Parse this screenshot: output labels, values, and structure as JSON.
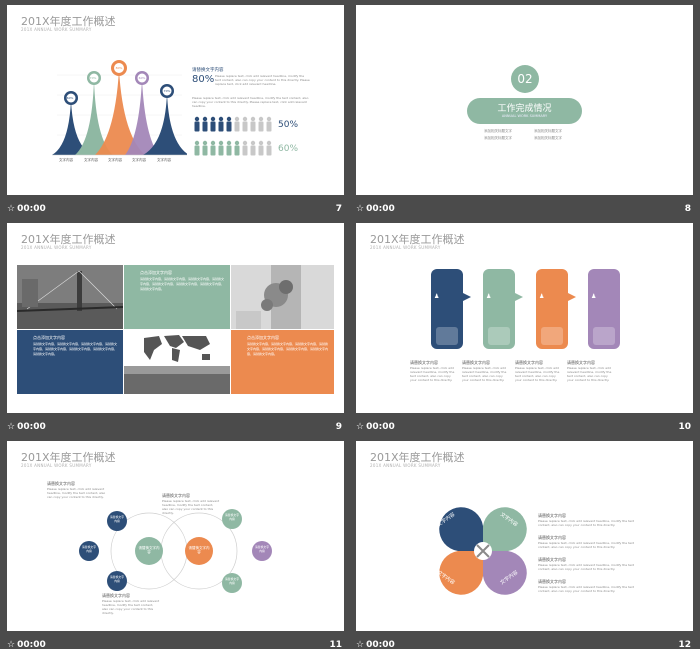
{
  "slides": [
    {
      "number": "7",
      "time": "00:00",
      "title": "201X年度工作概述",
      "subtitle": "201X ANNUAL WORK SUMMARY",
      "pin_labels": [
        "60%",
        "70%",
        "80%",
        "60%",
        "70%"
      ],
      "x_labels": [
        "文字内容",
        "文字内容",
        "文字内容",
        "文字内容",
        "文字内容"
      ],
      "heading": "请替换文字内容",
      "percent_big": "80%",
      "paragraph": "Please replace text, click add relevant headline, modify the text content, also can copy your content to this directly. Please replace text, click add relevant headline.",
      "percent_mid": "50%",
      "percent_low": "60%",
      "colors": {
        "navy": "#2d4e78",
        "sage": "#8fb8a3",
        "orange": "#ec8a4f",
        "purple": "#a387b8"
      }
    },
    {
      "number": "8",
      "time": "00:00",
      "chapter": "02",
      "chapter_title": "工作完成情况",
      "chapter_sub": "ANNUAL WORK SUMMARY",
      "items": [
        "添加相关标题文字",
        "添加相关标题文字",
        "添加相关标题文字",
        "添加相关标题文字"
      ]
    },
    {
      "number": "9",
      "time": "00:00",
      "title": "201X年度工作概述",
      "subtitle": "201X ANNUAL WORK SUMMARY",
      "heading": "点击添加文字内容",
      "text": "请替换文字内容，请替换文字内容，请替换文字内容，请替换文字内容，请替换文字内容，请替换文字内容，请替换文字内容，请替换文字内容。"
    },
    {
      "number": "10",
      "time": "00:00",
      "title": "201X年度工作概述",
      "subtitle": "201X ANNUAL WORK SUMMARY",
      "heading": "请替换文字内容",
      "paragraph": "Please replace text, click add relevant headline, modify the text content, also can copy your content to this directly."
    },
    {
      "number": "11",
      "time": "00:00",
      "title": "201X年度工作概述",
      "subtitle": "201X ANNUAL WORK SUMMARY",
      "heading": "请替换文字内容",
      "paragraph": "Please replace text, click add relevant headline, modify the text content, also can copy your content to this directly.",
      "center_left": "请替换文字内容",
      "center_right": "请替换文字内容",
      "node_text": "请替换文字内容"
    },
    {
      "number": "12",
      "time": "00:00",
      "title": "201X年度工作概述",
      "subtitle": "201X ANNUAL WORK SUMMARY",
      "knot_label": "文字内容",
      "heading": "请替换文字内容",
      "paragraph": "Please replace text, click add relevant headline, modify the text content, also can copy your content to this directly."
    }
  ]
}
